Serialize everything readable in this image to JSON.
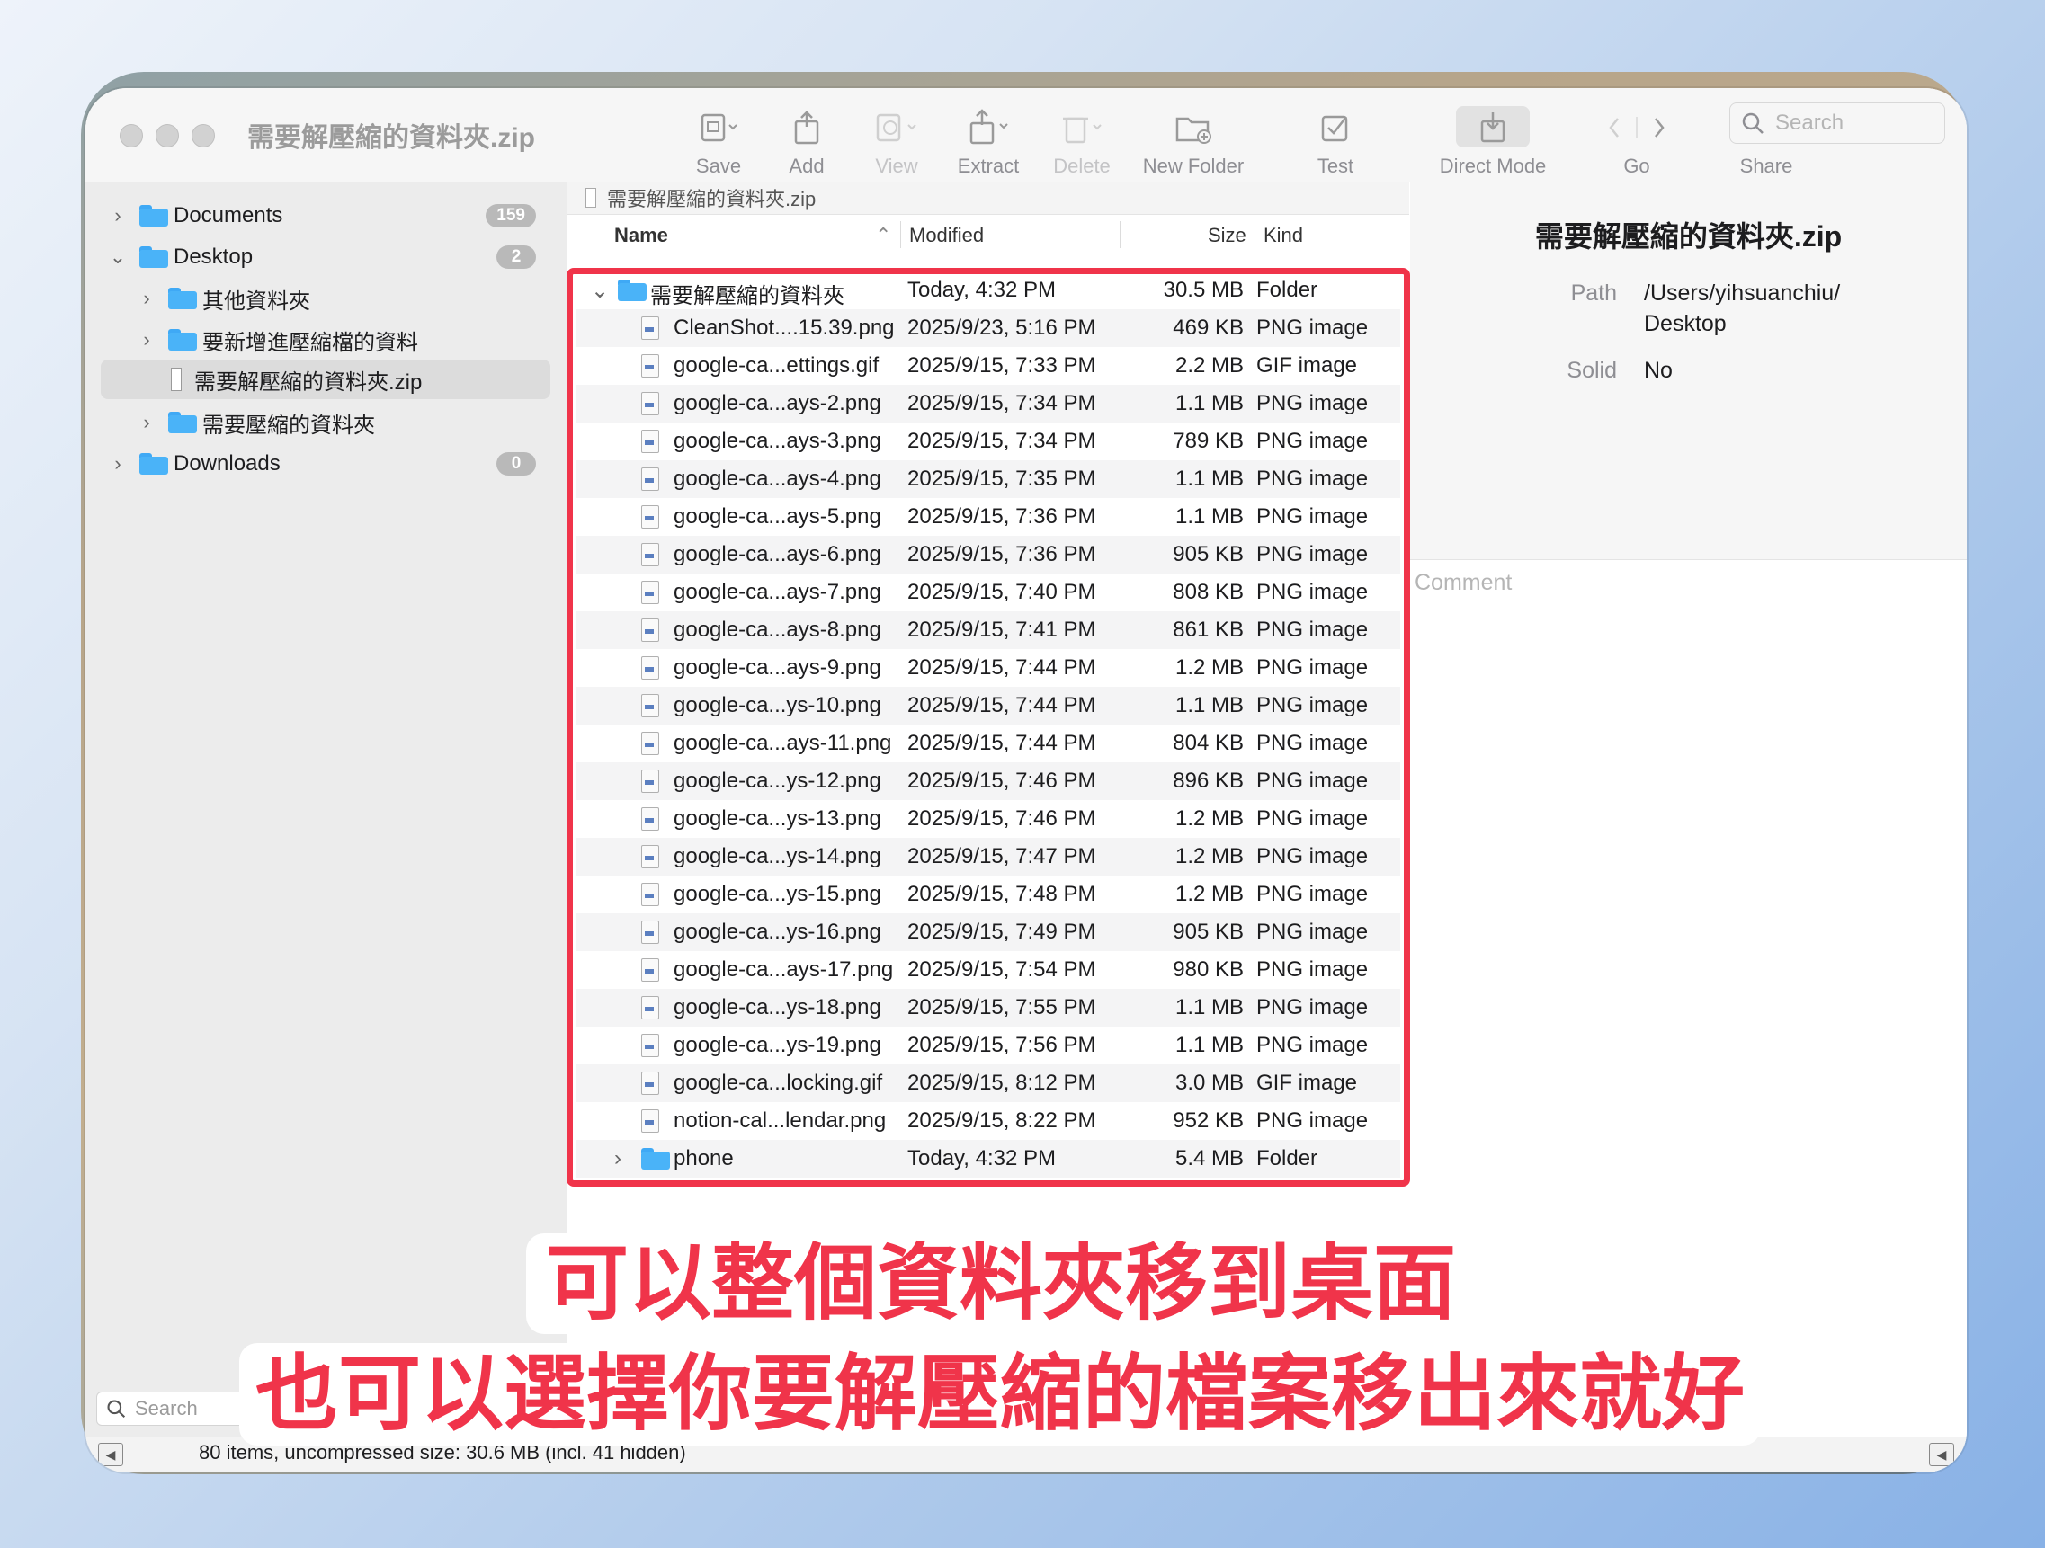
{
  "window": {
    "title": "需要解壓縮的資料夾.zip"
  },
  "toolbar": {
    "save": "Save",
    "add": "Add",
    "view": "View",
    "extract": "Extract",
    "delete": "Delete",
    "new_folder": "New Folder",
    "test": "Test",
    "direct_mode": "Direct Mode",
    "go": "Go",
    "share": "Share",
    "search_placeholder": "Search"
  },
  "sidebar": {
    "items": [
      {
        "label": "Documents",
        "badge": "159"
      },
      {
        "label": "Desktop",
        "badge": "2"
      },
      {
        "label": "其他資料夾"
      },
      {
        "label": "要新增進壓縮檔的資料"
      },
      {
        "label": "需要解壓縮的資料夾.zip"
      },
      {
        "label": "需要壓縮的資料夾"
      },
      {
        "label": "Downloads",
        "badge": "0"
      }
    ],
    "search_placeholder": "Search"
  },
  "pathbar": {
    "label": "需要解壓縮的資料夾.zip"
  },
  "columns": {
    "name": "Name",
    "modified": "Modified",
    "size": "Size",
    "kind": "Kind"
  },
  "rows": [
    {
      "name": "需要解壓縮的資料夾",
      "modified": "Today, 4:32 PM",
      "size": "30.5 MB",
      "kind": "Folder"
    },
    {
      "name": "CleanShot....15.39.png",
      "modified": "2025/9/23, 5:16 PM",
      "size": "469 KB",
      "kind": "PNG image"
    },
    {
      "name": "google-ca...ettings.gif",
      "modified": "2025/9/15, 7:33 PM",
      "size": "2.2 MB",
      "kind": "GIF image"
    },
    {
      "name": "google-ca...ays-2.png",
      "modified": "2025/9/15, 7:34 PM",
      "size": "1.1 MB",
      "kind": "PNG image"
    },
    {
      "name": "google-ca...ays-3.png",
      "modified": "2025/9/15, 7:34 PM",
      "size": "789 KB",
      "kind": "PNG image"
    },
    {
      "name": "google-ca...ays-4.png",
      "modified": "2025/9/15, 7:35 PM",
      "size": "1.1 MB",
      "kind": "PNG image"
    },
    {
      "name": "google-ca...ays-5.png",
      "modified": "2025/9/15, 7:36 PM",
      "size": "1.1 MB",
      "kind": "PNG image"
    },
    {
      "name": "google-ca...ays-6.png",
      "modified": "2025/9/15, 7:36 PM",
      "size": "905 KB",
      "kind": "PNG image"
    },
    {
      "name": "google-ca...ays-7.png",
      "modified": "2025/9/15, 7:40 PM",
      "size": "808 KB",
      "kind": "PNG image"
    },
    {
      "name": "google-ca...ays-8.png",
      "modified": "2025/9/15, 7:41 PM",
      "size": "861 KB",
      "kind": "PNG image"
    },
    {
      "name": "google-ca...ays-9.png",
      "modified": "2025/9/15, 7:44 PM",
      "size": "1.2 MB",
      "kind": "PNG image"
    },
    {
      "name": "google-ca...ys-10.png",
      "modified": "2025/9/15, 7:44 PM",
      "size": "1.1 MB",
      "kind": "PNG image"
    },
    {
      "name": "google-ca...ays-11.png",
      "modified": "2025/9/15, 7:44 PM",
      "size": "804 KB",
      "kind": "PNG image"
    },
    {
      "name": "google-ca...ys-12.png",
      "modified": "2025/9/15, 7:46 PM",
      "size": "896 KB",
      "kind": "PNG image"
    },
    {
      "name": "google-ca...ys-13.png",
      "modified": "2025/9/15, 7:46 PM",
      "size": "1.2 MB",
      "kind": "PNG image"
    },
    {
      "name": "google-ca...ys-14.png",
      "modified": "2025/9/15, 7:47 PM",
      "size": "1.2 MB",
      "kind": "PNG image"
    },
    {
      "name": "google-ca...ys-15.png",
      "modified": "2025/9/15, 7:48 PM",
      "size": "1.2 MB",
      "kind": "PNG image"
    },
    {
      "name": "google-ca...ys-16.png",
      "modified": "2025/9/15, 7:49 PM",
      "size": "905 KB",
      "kind": "PNG image"
    },
    {
      "name": "google-ca...ays-17.png",
      "modified": "2025/9/15, 7:54 PM",
      "size": "980 KB",
      "kind": "PNG image"
    },
    {
      "name": "google-ca...ys-18.png",
      "modified": "2025/9/15, 7:55 PM",
      "size": "1.1 MB",
      "kind": "PNG image"
    },
    {
      "name": "google-ca...ys-19.png",
      "modified": "2025/9/15, 7:56 PM",
      "size": "1.1 MB",
      "kind": "PNG image"
    },
    {
      "name": "google-ca...locking.gif",
      "modified": "2025/9/15, 8:12 PM",
      "size": "3.0 MB",
      "kind": "GIF image"
    },
    {
      "name": "notion-cal...lendar.png",
      "modified": "2025/9/15, 8:22 PM",
      "size": "952 KB",
      "kind": "PNG image"
    },
    {
      "name": "phone",
      "modified": "Today, 4:32 PM",
      "size": "5.4 MB",
      "kind": "Folder"
    }
  ],
  "info": {
    "title": "需要解壓縮的資料夾.zip",
    "path_label": "Path",
    "path_line1": "/Users/yihsuanchiu/",
    "path_line2": "Desktop",
    "solid_label": "Solid",
    "solid_value": "No",
    "comment_placeholder": "Comment"
  },
  "status": {
    "text": "80 items, uncompressed size: 30.6 MB (incl. 41 hidden)"
  },
  "captions": {
    "line1": "可以整個資料夾移到桌面",
    "line2": "也可以選擇你要解壓縮的檔案移出來就好"
  },
  "colors": {
    "accent_red": "#f0344a",
    "folder_blue": "#4ab3f8"
  }
}
